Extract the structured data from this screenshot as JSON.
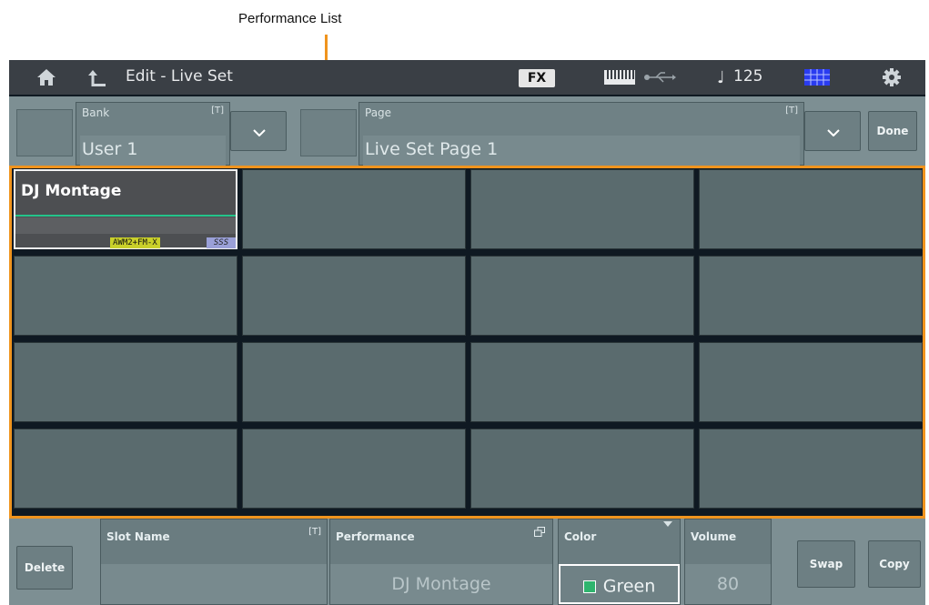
{
  "annotation": {
    "label": "Performance List"
  },
  "header": {
    "title": "Edit - Live Set",
    "fx_label": "FX",
    "tempo": "125",
    "icons": [
      "home-icon",
      "back-icon",
      "keyboard-icon",
      "usb-icon",
      "note-icon",
      "grid-icon",
      "gear-icon"
    ]
  },
  "controls": {
    "bank": {
      "label": "Bank",
      "value": "User 1",
      "text_mark": "[T]"
    },
    "page": {
      "label": "Page",
      "value": "Live Set Page 1",
      "text_mark": "[T]"
    },
    "done_label": "Done"
  },
  "slots": [
    {
      "name": "DJ Montage",
      "selected": true,
      "tags": [
        "AWM2+FM-X",
        "SSS"
      ]
    },
    {
      "name": ""
    },
    {
      "name": ""
    },
    {
      "name": ""
    },
    {
      "name": ""
    },
    {
      "name": ""
    },
    {
      "name": ""
    },
    {
      "name": ""
    },
    {
      "name": ""
    },
    {
      "name": ""
    },
    {
      "name": ""
    },
    {
      "name": ""
    },
    {
      "name": ""
    },
    {
      "name": ""
    },
    {
      "name": ""
    },
    {
      "name": ""
    }
  ],
  "bottom": {
    "delete_label": "Delete",
    "slot_name": {
      "label": "Slot Name",
      "value": "",
      "text_mark": "[T]"
    },
    "performance": {
      "label": "Performance",
      "value": "DJ Montage"
    },
    "color": {
      "label": "Color",
      "value": "Green",
      "swatch": "#2fb46e"
    },
    "volume": {
      "label": "Volume",
      "value": "80"
    },
    "swap_label": "Swap",
    "copy_label": "Copy"
  },
  "colors": {
    "accent_orange": "#f0941e",
    "slot_bg": "#5a6b6e",
    "panel_bg": "#7d8f93",
    "active_bar": "#23c48a"
  }
}
